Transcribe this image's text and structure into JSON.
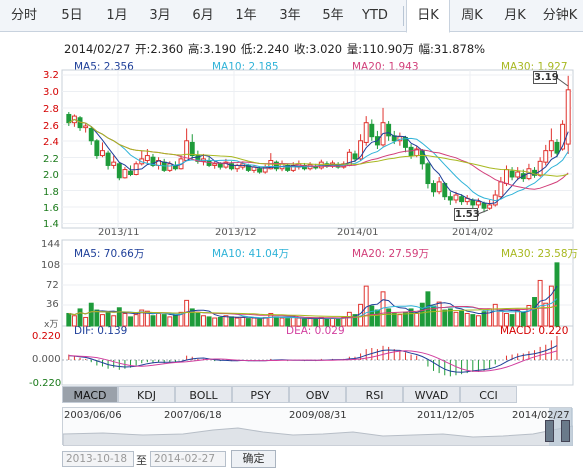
{
  "tabs": [
    "分时",
    "5日",
    "1月",
    "3月",
    "6月",
    "1年",
    "3年",
    "5年",
    "YTD",
    "日K",
    "周K",
    "月K",
    "分钟K"
  ],
  "active_tab": "日K",
  "info": {
    "date": "2014/02/27",
    "open": "开:2.360",
    "high": "高:3.190",
    "low": "低:2.240",
    "close": "收:3.020",
    "volume": "量:110.90万",
    "amplitude": "幅:31.878%"
  },
  "price_legend": {
    "ma5": "MA5: 2.356",
    "ma10": "MA10: 2.185",
    "ma20": "MA20: 1.943",
    "ma30": "MA30: 1.927"
  },
  "price_axis": [
    "3.2",
    "3.0",
    "2.8",
    "2.6",
    "2.4",
    "2.2",
    "2.0",
    "1.8",
    "1.6",
    "1.4"
  ],
  "price_axis_pct_hint": "",
  "high_marker": "3.19",
  "low_marker": "1.53",
  "time_labels": [
    "2013/11",
    "2013/12",
    "2014/01",
    "2014/02"
  ],
  "volume_legend": {
    "ma5": "MA5: 70.66万",
    "ma10": "MA10: 41.04万",
    "ma20": "MA20: 27.59万",
    "ma30": "MA30: 23.58万"
  },
  "volume_axis": [
    "144",
    "108",
    "72",
    "36",
    "x万"
  ],
  "macd_legend": {
    "dif": "DIF: 0.139",
    "dea": "DEA: 0.029",
    "macd": "MACD: 0.220"
  },
  "macd_axis": [
    "0.220",
    "0.000",
    "-0.220"
  ],
  "indicator_tabs": [
    "MACD",
    "KDJ",
    "BOLL",
    "PSY",
    "OBV",
    "RSI",
    "WVAD",
    "CCI"
  ],
  "active_indicator": "MACD",
  "range_dates": [
    "2003/06/06",
    "2007/06/18",
    "2009/08/31",
    "2011/12/05",
    "2014/02/27"
  ],
  "date_from": "2013-10-18",
  "to_label": "至",
  "date_to": "2014-02-27",
  "confirm_label": "确定",
  "colors": {
    "up": "#e0342f",
    "down": "#1e9b3a",
    "ma5": "#1e3f99",
    "ma10": "#2fb3d8",
    "ma20": "#d23f7a",
    "ma30": "#a8b820",
    "dif": "#1e3f99",
    "dea": "#d23f9f"
  },
  "chart_data": {
    "type": "candlestick",
    "title": "",
    "x_range": [
      "2013-10-18",
      "2014-02-27"
    ],
    "ylim": [
      1.4,
      3.2
    ],
    "candles": [
      {
        "o": 2.72,
        "c": 2.62,
        "h": 2.75,
        "l": 2.58
      },
      {
        "o": 2.62,
        "c": 2.7,
        "h": 2.72,
        "l": 2.57
      },
      {
        "o": 2.68,
        "c": 2.56,
        "h": 2.7,
        "l": 2.52
      },
      {
        "o": 2.56,
        "c": 2.58,
        "h": 2.62,
        "l": 2.5
      },
      {
        "o": 2.55,
        "c": 2.4,
        "h": 2.58,
        "l": 2.35
      },
      {
        "o": 2.4,
        "c": 2.22,
        "h": 2.42,
        "l": 2.18
      },
      {
        "o": 2.22,
        "c": 2.28,
        "h": 2.38,
        "l": 2.2
      },
      {
        "o": 2.25,
        "c": 2.1,
        "h": 2.28,
        "l": 2.05
      },
      {
        "o": 2.1,
        "c": 2.14,
        "h": 2.22,
        "l": 2.06
      },
      {
        "o": 2.12,
        "c": 1.95,
        "h": 2.14,
        "l": 1.92
      },
      {
        "o": 1.95,
        "c": 2.05,
        "h": 2.08,
        "l": 1.94
      },
      {
        "o": 2.03,
        "c": 1.99,
        "h": 2.1,
        "l": 1.97
      },
      {
        "o": 1.99,
        "c": 2.12,
        "h": 2.15,
        "l": 1.98
      },
      {
        "o": 2.12,
        "c": 2.18,
        "h": 2.28,
        "l": 2.1
      },
      {
        "o": 2.16,
        "c": 2.22,
        "h": 2.3,
        "l": 2.12
      },
      {
        "o": 2.2,
        "c": 2.1,
        "h": 2.24,
        "l": 2.08
      },
      {
        "o": 2.1,
        "c": 2.16,
        "h": 2.2,
        "l": 2.05
      },
      {
        "o": 2.14,
        "c": 2.04,
        "h": 2.18,
        "l": 2.02
      },
      {
        "o": 2.04,
        "c": 2.12,
        "h": 2.15,
        "l": 2.02
      },
      {
        "o": 2.1,
        "c": 2.06,
        "h": 2.15,
        "l": 2.04
      },
      {
        "o": 2.06,
        "c": 2.18,
        "h": 2.22,
        "l": 2.05
      },
      {
        "o": 2.16,
        "c": 2.4,
        "h": 2.55,
        "l": 2.15
      },
      {
        "o": 2.38,
        "c": 2.22,
        "h": 2.48,
        "l": 2.18
      },
      {
        "o": 2.22,
        "c": 2.15,
        "h": 2.28,
        "l": 2.12
      },
      {
        "o": 2.15,
        "c": 2.18,
        "h": 2.24,
        "l": 2.1
      },
      {
        "o": 2.16,
        "c": 2.1,
        "h": 2.2,
        "l": 2.08
      },
      {
        "o": 2.1,
        "c": 2.12,
        "h": 2.16,
        "l": 2.06
      },
      {
        "o": 2.12,
        "c": 2.08,
        "h": 2.14,
        "l": 2.05
      },
      {
        "o": 2.08,
        "c": 2.14,
        "h": 2.18,
        "l": 2.06
      },
      {
        "o": 2.12,
        "c": 2.06,
        "h": 2.15,
        "l": 2.04
      },
      {
        "o": 2.06,
        "c": 2.1,
        "h": 2.12,
        "l": 2.02
      },
      {
        "o": 2.08,
        "c": 2.12,
        "h": 2.15,
        "l": 2.05
      },
      {
        "o": 2.1,
        "c": 2.04,
        "h": 2.12,
        "l": 2.02
      },
      {
        "o": 2.04,
        "c": 2.08,
        "h": 2.1,
        "l": 2.01
      },
      {
        "o": 2.06,
        "c": 2.02,
        "h": 2.09,
        "l": 2.0
      },
      {
        "o": 2.02,
        "c": 2.08,
        "h": 2.11,
        "l": 2.0
      },
      {
        "o": 2.06,
        "c": 2.16,
        "h": 2.25,
        "l": 2.05
      },
      {
        "o": 2.14,
        "c": 2.06,
        "h": 2.16,
        "l": 2.03
      },
      {
        "o": 2.06,
        "c": 2.12,
        "h": 2.16,
        "l": 2.03
      },
      {
        "o": 2.1,
        "c": 2.04,
        "h": 2.12,
        "l": 2.02
      },
      {
        "o": 2.04,
        "c": 2.1,
        "h": 2.14,
        "l": 2.02
      },
      {
        "o": 2.08,
        "c": 2.12,
        "h": 2.16,
        "l": 2.05
      },
      {
        "o": 2.1,
        "c": 2.06,
        "h": 2.13,
        "l": 2.04
      },
      {
        "o": 2.06,
        "c": 2.11,
        "h": 2.14,
        "l": 2.04
      },
      {
        "o": 2.09,
        "c": 2.07,
        "h": 2.12,
        "l": 2.05
      },
      {
        "o": 2.07,
        "c": 2.14,
        "h": 2.17,
        "l": 2.05
      },
      {
        "o": 2.12,
        "c": 2.09,
        "h": 2.15,
        "l": 2.07
      },
      {
        "o": 2.09,
        "c": 2.13,
        "h": 2.16,
        "l": 2.07
      },
      {
        "o": 2.11,
        "c": 2.08,
        "h": 2.14,
        "l": 2.06
      },
      {
        "o": 2.08,
        "c": 2.12,
        "h": 2.15,
        "l": 2.06
      },
      {
        "o": 2.1,
        "c": 2.26,
        "h": 2.3,
        "l": 2.09
      },
      {
        "o": 2.24,
        "c": 2.18,
        "h": 2.28,
        "l": 2.14
      },
      {
        "o": 2.18,
        "c": 2.4,
        "h": 2.48,
        "l": 2.16
      },
      {
        "o": 2.38,
        "c": 2.62,
        "h": 2.7,
        "l": 2.34
      },
      {
        "o": 2.6,
        "c": 2.45,
        "h": 2.66,
        "l": 2.4
      },
      {
        "o": 2.45,
        "c": 2.35,
        "h": 2.52,
        "l": 2.3
      },
      {
        "o": 2.35,
        "c": 2.62,
        "h": 2.8,
        "l": 2.33
      },
      {
        "o": 2.6,
        "c": 2.46,
        "h": 2.64,
        "l": 2.4
      },
      {
        "o": 2.46,
        "c": 2.4,
        "h": 2.52,
        "l": 2.36
      },
      {
        "o": 2.4,
        "c": 2.45,
        "h": 2.5,
        "l": 2.34
      },
      {
        "o": 2.44,
        "c": 2.32,
        "h": 2.46,
        "l": 2.26
      },
      {
        "o": 2.32,
        "c": 2.22,
        "h": 2.36,
        "l": 2.18
      },
      {
        "o": 2.22,
        "c": 2.3,
        "h": 2.34,
        "l": 2.2
      },
      {
        "o": 2.28,
        "c": 2.12,
        "h": 2.3,
        "l": 2.05
      },
      {
        "o": 2.12,
        "c": 1.88,
        "h": 2.14,
        "l": 1.82
      },
      {
        "o": 1.88,
        "c": 1.78,
        "h": 1.92,
        "l": 1.72
      },
      {
        "o": 1.78,
        "c": 1.9,
        "h": 1.96,
        "l": 1.75
      },
      {
        "o": 1.88,
        "c": 1.72,
        "h": 1.9,
        "l": 1.68
      },
      {
        "o": 1.72,
        "c": 1.68,
        "h": 1.78,
        "l": 1.62
      },
      {
        "o": 1.68,
        "c": 1.74,
        "h": 1.78,
        "l": 1.64
      },
      {
        "o": 1.72,
        "c": 1.66,
        "h": 1.75,
        "l": 1.62
      },
      {
        "o": 1.66,
        "c": 1.7,
        "h": 1.74,
        "l": 1.62
      },
      {
        "o": 1.68,
        "c": 1.62,
        "h": 1.7,
        "l": 1.58
      },
      {
        "o": 1.62,
        "c": 1.66,
        "h": 1.7,
        "l": 1.58
      },
      {
        "o": 1.64,
        "c": 1.58,
        "h": 1.66,
        "l": 1.53
      },
      {
        "o": 1.58,
        "c": 1.62,
        "h": 1.68,
        "l": 1.56
      },
      {
        "o": 1.62,
        "c": 1.74,
        "h": 1.8,
        "l": 1.6
      },
      {
        "o": 1.72,
        "c": 1.9,
        "h": 1.96,
        "l": 1.7
      },
      {
        "o": 1.88,
        "c": 2.05,
        "h": 2.1,
        "l": 1.85
      },
      {
        "o": 2.03,
        "c": 1.96,
        "h": 2.08,
        "l": 1.92
      },
      {
        "o": 1.96,
        "c": 2.02,
        "h": 2.08,
        "l": 1.92
      },
      {
        "o": 2.0,
        "c": 1.94,
        "h": 2.05,
        "l": 1.9
      },
      {
        "o": 1.94,
        "c": 2.06,
        "h": 2.12,
        "l": 1.92
      },
      {
        "o": 2.04,
        "c": 1.98,
        "h": 2.08,
        "l": 1.95
      },
      {
        "o": 1.98,
        "c": 2.15,
        "h": 2.2,
        "l": 1.96
      },
      {
        "o": 2.14,
        "c": 2.28,
        "h": 2.35,
        "l": 2.1
      },
      {
        "o": 2.28,
        "c": 2.4,
        "h": 2.55,
        "l": 2.2
      },
      {
        "o": 2.38,
        "c": 2.25,
        "h": 2.42,
        "l": 2.2
      },
      {
        "o": 2.3,
        "c": 2.6,
        "h": 2.65,
        "l": 2.28
      },
      {
        "o": 2.36,
        "c": 3.02,
        "h": 3.19,
        "l": 2.24
      }
    ],
    "volume_values": [
      22,
      18,
      30,
      15,
      40,
      28,
      20,
      25,
      18,
      32,
      22,
      16,
      20,
      28,
      26,
      18,
      22,
      20,
      16,
      18,
      24,
      45,
      30,
      22,
      18,
      16,
      14,
      15,
      18,
      16,
      14,
      15,
      13,
      14,
      12,
      15,
      22,
      16,
      14,
      13,
      15,
      14,
      12,
      13,
      12,
      15,
      13,
      14,
      12,
      15,
      24,
      20,
      38,
      70,
      35,
      28,
      60,
      30,
      22,
      20,
      24,
      30,
      22,
      40,
      60,
      35,
      42,
      28,
      30,
      24,
      26,
      22,
      20,
      18,
      25,
      30,
      38,
      26,
      22,
      20,
      28,
      24,
      36,
      50,
      80,
      40,
      70,
      110.9
    ],
    "macd_values": [
      0.05,
      0.04,
      0.02,
      0.01,
      -0.02,
      -0.05,
      -0.06,
      -0.08,
      -0.07,
      -0.09,
      -0.08,
      -0.07,
      -0.05,
      -0.03,
      -0.02,
      -0.03,
      -0.02,
      -0.03,
      -0.02,
      -0.02,
      0,
      0.04,
      0.03,
      0.01,
      0.01,
      0,
      -0.01,
      -0.01,
      0,
      -0.01,
      -0.01,
      0,
      -0.01,
      -0.01,
      -0.01,
      0,
      0.01,
      0,
      0,
      -0.01,
      0,
      0,
      -0.01,
      0,
      -0.01,
      0.01,
      0,
      0.01,
      0,
      0.01,
      0.03,
      0.03,
      0.06,
      0.1,
      0.11,
      0.1,
      0.13,
      0.12,
      0.1,
      0.09,
      0.07,
      0.05,
      0.04,
      0,
      -0.06,
      -0.1,
      -0.12,
      -0.14,
      -0.15,
      -0.14,
      -0.13,
      -0.12,
      -0.11,
      -0.11,
      -0.1,
      -0.08,
      -0.04,
      0,
      0.04,
      0.05,
      0.06,
      0.06,
      0.08,
      0.09,
      0.12,
      0.14,
      0.18,
      0.22
    ]
  }
}
